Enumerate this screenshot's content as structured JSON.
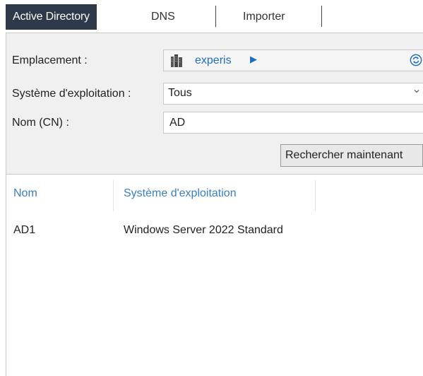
{
  "tabs": [
    {
      "label": "Active Directory",
      "active": true
    },
    {
      "label": "DNS",
      "active": false
    },
    {
      "label": "Importer",
      "active": false
    }
  ],
  "form": {
    "location_label": "Emplacement :",
    "location_value": "experis",
    "os_label": "Système d'exploitation :",
    "os_selected": "Tous",
    "cn_label": "Nom (CN) :",
    "cn_value": "AD"
  },
  "search_button_label": "Rechercher maintenant",
  "results": {
    "columns": [
      "Nom",
      "Système d'exploitation"
    ],
    "rows": [
      {
        "name": "AD1",
        "os": "Windows Server 2022 Standard"
      }
    ]
  },
  "colors": {
    "active_tab_bg": "#2e3a4a",
    "link_blue": "#1c6ec0",
    "header_blue": "#3a7ec4",
    "panel_bg": "#f0f0f0"
  },
  "icons": {
    "location": "server-building-icon",
    "refresh": "refresh-icon",
    "dropdown": "chevron-down-icon",
    "breadcrumb": "triangle-right-icon"
  }
}
